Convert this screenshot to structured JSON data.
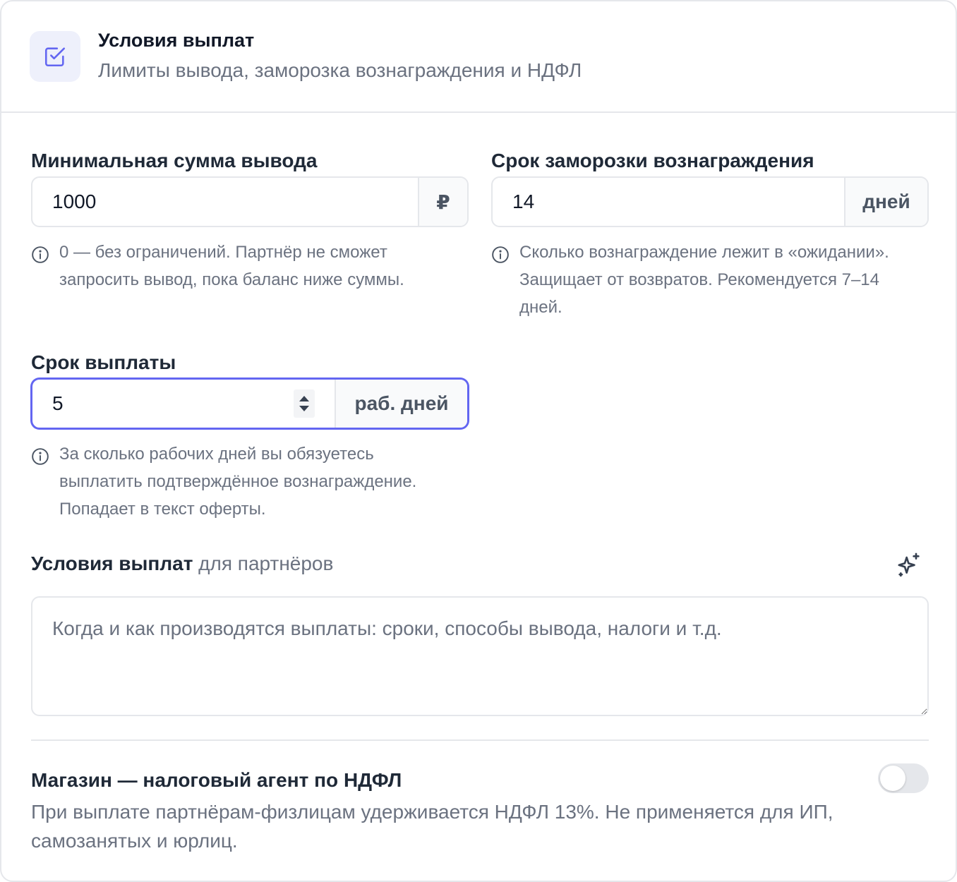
{
  "header": {
    "title": "Условия выплат",
    "subtitle": "Лимиты вывода, заморозка вознаграждения и НДФЛ",
    "icon": "checkbox-edit-icon"
  },
  "min_withdrawal": {
    "label": "Минимальная сумма вывода",
    "value": "1000",
    "unit": "₽",
    "hint": "0 — без ограничений. Партнёр не сможет запросить вывод, пока баланс ниже суммы."
  },
  "freeze_period": {
    "label": "Срок заморозки вознаграждения",
    "value": "14",
    "unit": "дней",
    "hint": "Сколько вознаграждение лежит в «ожидании». Защищает от возвратов. Рекомендуется 7–14 дней."
  },
  "payout_term": {
    "label": "Срок выплаты",
    "value": "5",
    "unit": "раб. дней",
    "hint": "За сколько рабочих дней вы обязуетесь выплатить подтверждённое вознаграждение. Попадает в текст оферты."
  },
  "terms": {
    "label_strong": "Условия выплат",
    "label_muted": " для партнёров",
    "placeholder": "Когда и как производятся выплаты: сроки, способы вывода, налоги и т.д.",
    "ai_icon": "sparkles-icon"
  },
  "tax_agent": {
    "title": "Магазин — налоговый агент по НДФЛ",
    "description": "При выплате партнёрам-физлицам удерживается НДФЛ 13%. Не применяется для ИП, самозанятых и юрлиц.",
    "enabled": false
  },
  "colors": {
    "accent": "#6366f1",
    "icon_bg": "#eef0fb",
    "border": "#e5e7eb",
    "muted_text": "#6b7280"
  }
}
